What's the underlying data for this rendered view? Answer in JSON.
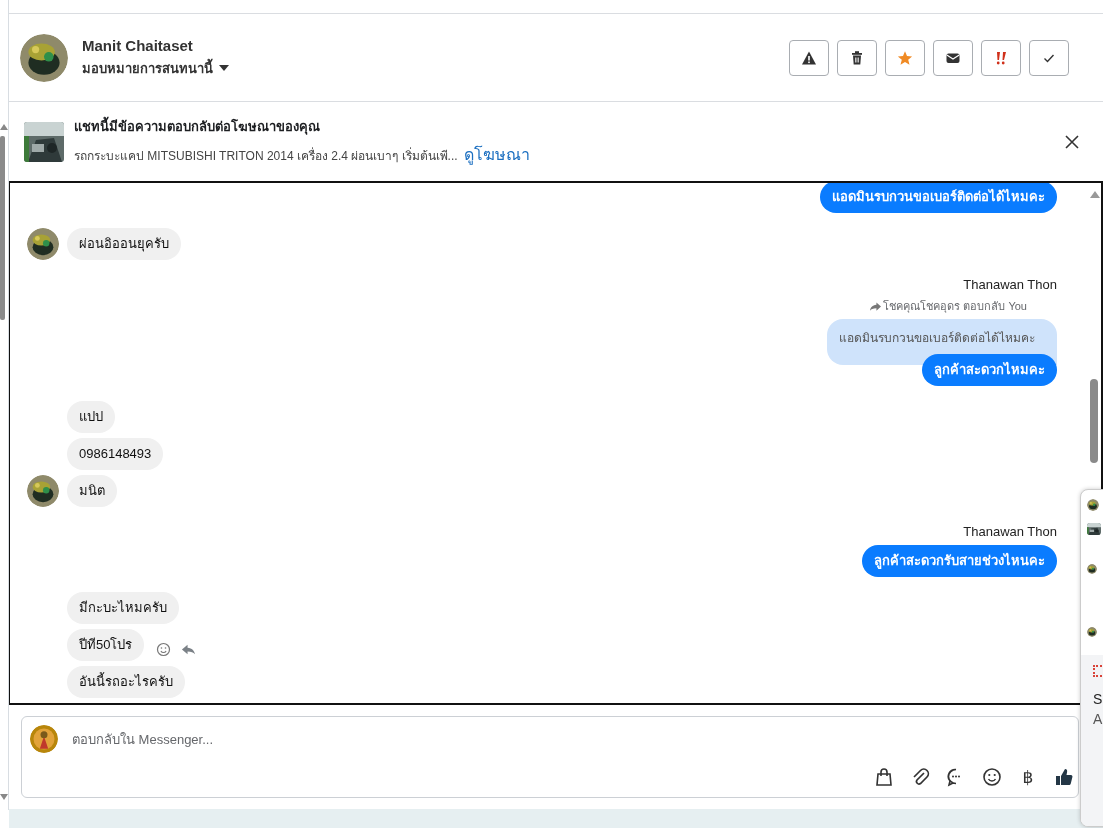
{
  "header": {
    "name": "Manit Chaitaset",
    "assign_label": "มอบหมายการสนทนานี้"
  },
  "actions": [
    {
      "kind": "report"
    },
    {
      "kind": "delete"
    },
    {
      "kind": "star"
    },
    {
      "kind": "unread"
    },
    {
      "kind": "spam"
    },
    {
      "kind": "done"
    }
  ],
  "ad": {
    "title": "แชทนี้มีข้อความตอบกลับต่อโฆษณาของคุณ",
    "description": "รถกระบะแคป MITSUBISHI TRITON 2014 เครื่อง 2.4 ผ่อนเบาๆ เริ่มต้นเพี...",
    "link": "ดูโฆษณา"
  },
  "messages": [
    {
      "kind": "outgoing",
      "text": "แอดมินรบกวนขอเบอร์ติดต่อได้ไหมคะ"
    },
    {
      "kind": "incoming",
      "text": "ผ่อนอิออนยุครับ",
      "avatar": true
    },
    {
      "kind": "sender_name",
      "text": "Thanawan Thon"
    },
    {
      "kind": "reply_note",
      "text": "โชคคุณโชคอุดร ตอบกลับ You"
    },
    {
      "kind": "quote",
      "text": "แอดมินรบกวนขอเบอร์ติดต่อได้ไหมคะ"
    },
    {
      "kind": "outgoing",
      "text": "ลูกค้าสะดวกไหมคะ"
    },
    {
      "kind": "incoming",
      "text": "แปป",
      "avatar": false
    },
    {
      "kind": "incoming",
      "text": "0986148493",
      "avatar": false
    },
    {
      "kind": "incoming",
      "text": "มนิต",
      "avatar": true
    },
    {
      "kind": "sender_name",
      "text": "Thanawan Thon"
    },
    {
      "kind": "outgoing",
      "text": "ลูกค้าสะดวกรับสายช่วงไหนคะ"
    },
    {
      "kind": "incoming",
      "text": "มีกะบะไหมครับ",
      "avatar": false
    },
    {
      "kind": "incoming",
      "text": "ปีที50โปร",
      "avatar": false,
      "actions": true
    },
    {
      "kind": "incoming",
      "text": "อันนี้รถอะไรครับ",
      "avatar": false
    }
  ],
  "composer": {
    "placeholder": "ตอบกลับใน Messenger...",
    "tools": [
      {
        "kind": "shop"
      },
      {
        "kind": "attach"
      },
      {
        "kind": "saved_replies"
      },
      {
        "kind": "emoji"
      },
      {
        "kind": "currency",
        "text": "฿"
      },
      {
        "kind": "like"
      }
    ]
  },
  "side_panel": {
    "letters": [
      "S",
      "A"
    ]
  }
}
